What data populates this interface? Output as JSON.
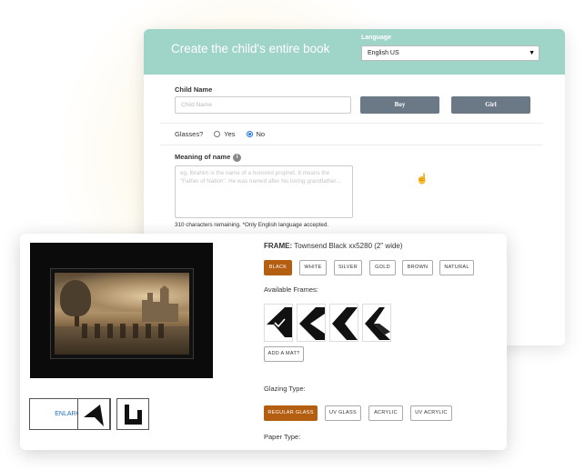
{
  "book_form": {
    "title": "Create the child's entire book",
    "language_label": "Language",
    "language_value": "English US",
    "child_name_label": "Child Name",
    "child_name_placeholder": "Child Name",
    "boy_label": "Boy",
    "girl_label": "Girl",
    "glasses_label": "Glasses?",
    "glasses_options": [
      "Yes",
      "No"
    ],
    "glasses_selected": "No",
    "meaning_label": "Meaning of name",
    "meaning_placeholder": "eg. Ibrahim is the name of a honored prophet. It means the \"Father of Nation\". He was named after his loving grandfather...",
    "chars_remaining": "310 characters remaining. *Only English language accepted."
  },
  "frame_picker": {
    "frame_label": "FRAME:",
    "frame_name": "Townsend Black xx5280 (2\" wide)",
    "colors": [
      "BLACK",
      "WHITE",
      "SILVER",
      "GOLD",
      "BROWN",
      "NATURAL"
    ],
    "selected_color": "BLACK",
    "available_frames_label": "Available Frames:",
    "add_mat_label": "ADD A MAT?",
    "enlarge_label": "ENLARGE",
    "glazing_label": "Glazing Type:",
    "glazing_options": [
      "REGULAR GLASS",
      "UV GLASS",
      "ACRYLIC",
      "UV ACRYLIC"
    ],
    "selected_glazing": "REGULAR GLASS",
    "paper_type_label": "Paper Type:"
  },
  "colors": {
    "header_teal": "#9fd4c9",
    "button_gray": "#6b7885",
    "selected_orange": "#b35e10",
    "link_blue": "#1e6fc2"
  },
  "icons": [
    "info-icon",
    "caret-down-icon",
    "checkmark-icon",
    "pointer-cursor-icon"
  ]
}
